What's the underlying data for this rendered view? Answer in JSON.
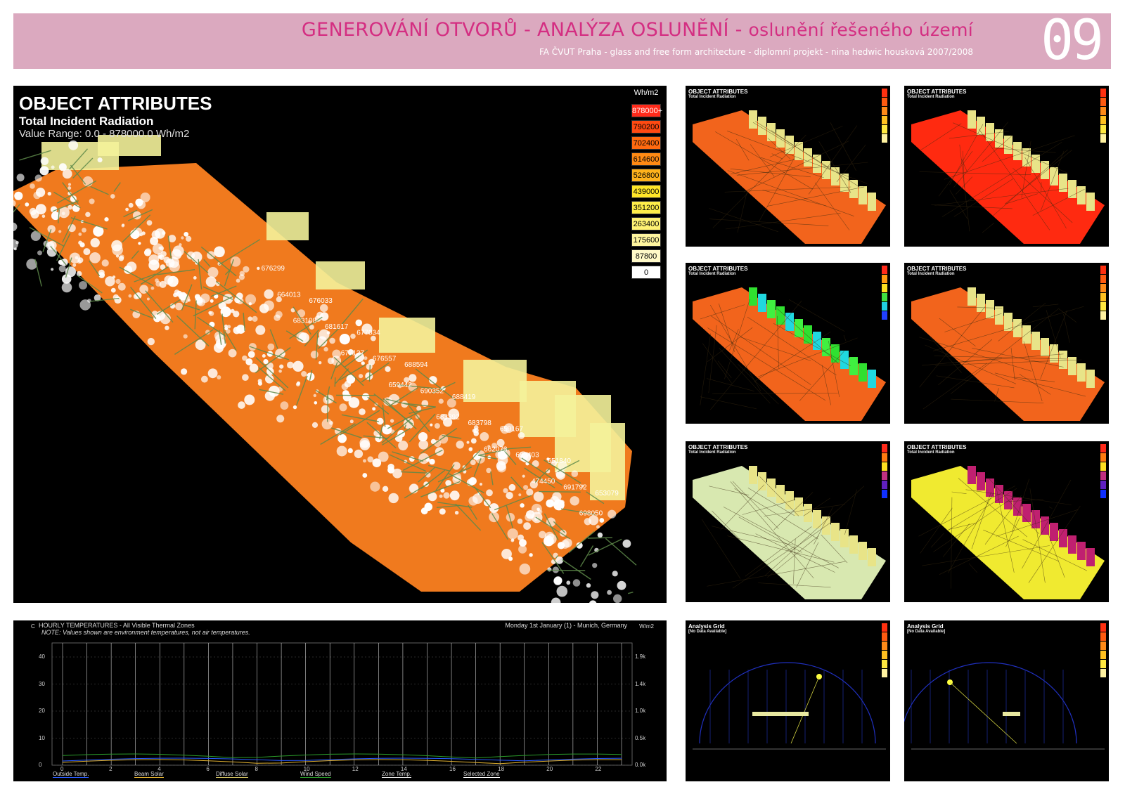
{
  "header": {
    "title_main": "GENEROVÁNÍ OTVORŮ - ANALÝZA OSLUNĚNÍ - ",
    "title_sub": "oslunění řešeného území",
    "subtitle": "FA ČVUT Praha - glass and free form architecture  - diplomní projekt - nina hedwic housková 2007/2008",
    "sheet_number": "09"
  },
  "main_view": {
    "heading": "OBJECT ATTRIBUTES",
    "subheading": "Total Incident Radiation",
    "range_line": "Value Range: 0.0 - 878000.0 Wh/m2",
    "legend_unit": "Wh/m2",
    "legend": [
      {
        "label": "878000+",
        "color": "#ff2a1a",
        "text_color": "#ffffff"
      },
      {
        "label": "790200",
        "color": "#ff4a12",
        "text_color": "#000000"
      },
      {
        "label": "702400",
        "color": "#ff6a10",
        "text_color": "#000000"
      },
      {
        "label": "614600",
        "color": "#ff8a14",
        "text_color": "#000000"
      },
      {
        "label": "526800",
        "color": "#ffb21c",
        "text_color": "#000000"
      },
      {
        "label": "439000",
        "color": "#ffe628",
        "text_color": "#000000"
      },
      {
        "label": "351200",
        "color": "#ffee4a",
        "text_color": "#000000"
      },
      {
        "label": "263400",
        "color": "#fff274",
        "text_color": "#000000"
      },
      {
        "label": "175600",
        "color": "#fff59e",
        "text_color": "#000000"
      },
      {
        "label": "87800",
        "color": "#fff9c8",
        "text_color": "#000000"
      },
      {
        "label": "0",
        "color": "#ffffff",
        "text_color": "#000000"
      }
    ],
    "value_labels": [
      "676299",
      "664013",
      "683108",
      "676033",
      "681617",
      "677127",
      "677034",
      "676557",
      "659442",
      "688594",
      "690352",
      "683392",
      "688419",
      "683798",
      "662073",
      "659167",
      "683403",
      "474450",
      "651840",
      "691792",
      "698050",
      "653079"
    ]
  },
  "thumbnails": [
    {
      "title": "OBJECT ATTRIBUTES",
      "sub": "Total Incident Radiation",
      "scheme": "warm"
    },
    {
      "title": "OBJECT ATTRIBUTES",
      "sub": "Total Incident Radiation",
      "scheme": "warm"
    },
    {
      "title": "OBJECT ATTRIBUTES",
      "sub": "Total Incident Radiation",
      "scheme": "rainbow"
    },
    {
      "title": "OBJECT ATTRIBUTES",
      "sub": "Total Incident Radiation",
      "scheme": "warm"
    },
    {
      "title": "OBJECT ATTRIBUTES",
      "sub": "Total Incident Radiation",
      "scheme": "blue"
    },
    {
      "title": "OBJECT ATTRIBUTES",
      "sub": "Total Incident Radiation",
      "scheme": "blue"
    },
    {
      "title": "Analysis Grid",
      "sub": "[No Data Available]",
      "scheme": "warm"
    },
    {
      "title": "Analysis Grid",
      "sub": "[No Data Available]",
      "scheme": "warm"
    }
  ],
  "chart": {
    "title": "HOURLY TEMPERATURES - All Visible Thermal Zones",
    "note": "NOTE: Values shown are environment temperatures, not air temperatures.",
    "location": "Monday 1st January (1) - Munich, Germany",
    "left_unit": "C",
    "right_unit": "W/m2",
    "y_ticks": [
      "40",
      "30",
      "20",
      "10",
      "0"
    ],
    "y2_ticks": [
      "1.9k",
      "1.4k",
      "1.0k",
      "0.5k",
      "0.0k"
    ],
    "x_ticks": [
      "0",
      "2",
      "4",
      "6",
      "8",
      "10",
      "12",
      "14",
      "16",
      "18",
      "20",
      "22"
    ],
    "legend": [
      {
        "label": "Outside Temp.",
        "color": "#2a5cff"
      },
      {
        "label": "Beam Solar",
        "color": "#e0b030"
      },
      {
        "label": "Diffuse Solar",
        "color": "#d0c060"
      },
      {
        "label": "Wind Speed",
        "color": "#2a9a2a"
      },
      {
        "label": "Zone Temp.",
        "color": "#e8e8e8"
      },
      {
        "label": "Selected Zone",
        "color": "#ffffff"
      }
    ]
  }
}
